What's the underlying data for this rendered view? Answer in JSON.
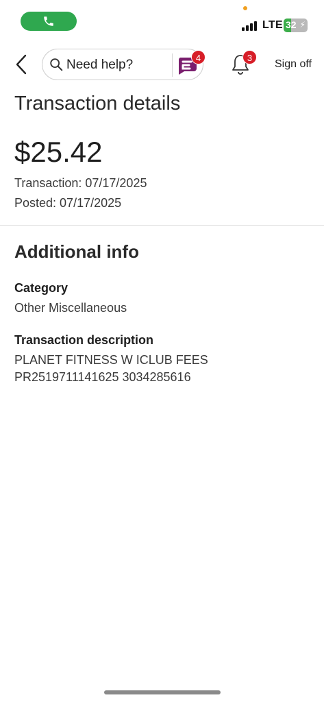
{
  "status_bar": {
    "network": "LTE",
    "battery_level": "32",
    "battery_fill_fraction": 0.32,
    "call_pill_color": "#2fa84f"
  },
  "nav": {
    "search_placeholder": "Need help?",
    "assistant_badge_count": "4",
    "notifications_badge_count": "3",
    "signoff_label": "Sign off",
    "badge_color": "#d71e28",
    "assistant_icon_color": "#7a1f6e"
  },
  "transaction": {
    "page_title": "Transaction details",
    "amount": "$25.42",
    "transaction_date": "Transaction: 07/17/2025",
    "posted_date": "Posted: 07/17/2025"
  },
  "additional_info": {
    "title": "Additional info",
    "category_label": "Category",
    "category_value": "Other Miscellaneous",
    "description_label": "Transaction description",
    "description_line1": "PLANET FITNESS W ICLUB FEES",
    "description_line2": "PR2519711141625 3034285616"
  }
}
